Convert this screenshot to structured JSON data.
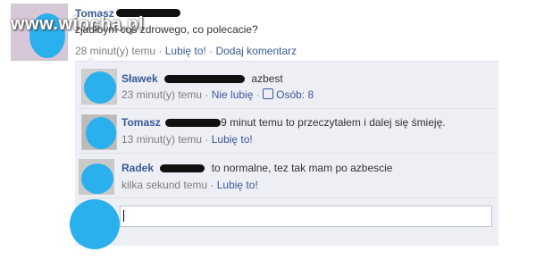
{
  "watermark": "www.wiocha.pl",
  "post": {
    "author": "Tomasz",
    "text": "zjadłbym coś zdrowego, co polecacie?",
    "time": "28 minut(y) temu",
    "like": "Lubię to!",
    "comment": "Dodaj komentarz",
    "dot": "·"
  },
  "comments": [
    {
      "name": "Sławek",
      "text": "azbest",
      "time": "23 minut(y) temu",
      "unlike": "Nie lubię",
      "likes": "Osób: 8"
    },
    {
      "name": "Tomasz",
      "text": "9 minut temu to przeczytałem i dalej się śmieję.",
      "time": "13 minut(y) temu",
      "like": "Lubię to!"
    },
    {
      "name": "Radek",
      "text": "to normalne, tez tak mam po azbescie",
      "time": "kilka sekund temu",
      "like": "Lubię to!"
    }
  ],
  "colors": {
    "link": "#3b5998",
    "panel": "#edeff4",
    "blob": "#2bb0ee"
  }
}
